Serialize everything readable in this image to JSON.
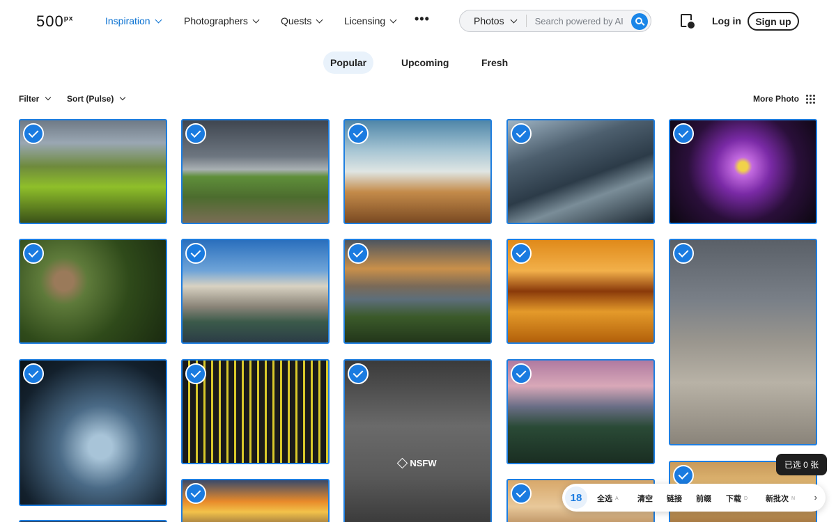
{
  "header": {
    "logo": "500",
    "logo_sup": "px",
    "nav": [
      {
        "label": "Inspiration",
        "active": true
      },
      {
        "label": "Photographers",
        "active": false
      },
      {
        "label": "Quests",
        "active": false
      },
      {
        "label": "Licensing",
        "active": false
      }
    ],
    "more": "•••",
    "search": {
      "type": "Photos",
      "placeholder": "Search powered by AI"
    },
    "login": "Log in",
    "signup": "Sign up"
  },
  "tabs": [
    "Popular",
    "Upcoming",
    "Fresh"
  ],
  "toolbar": {
    "filter": "Filter",
    "sort": "Sort (Pulse)",
    "more_photo": "More Photo"
  },
  "nsfw": "NSFW",
  "selection": {
    "selected_label": "已选 0 张",
    "count": "18",
    "actions": [
      {
        "label": "全选",
        "key": "A"
      },
      {
        "label": "清空",
        "key": ""
      },
      {
        "label": "链接",
        "key": ""
      },
      {
        "label": "前缀",
        "key": ""
      },
      {
        "label": "下载",
        "key": "D"
      },
      {
        "label": "新批次",
        "key": "N"
      }
    ],
    "next": "›"
  },
  "colors": {
    "accent": "#1a7be0",
    "nav_active": "#0870d1"
  }
}
